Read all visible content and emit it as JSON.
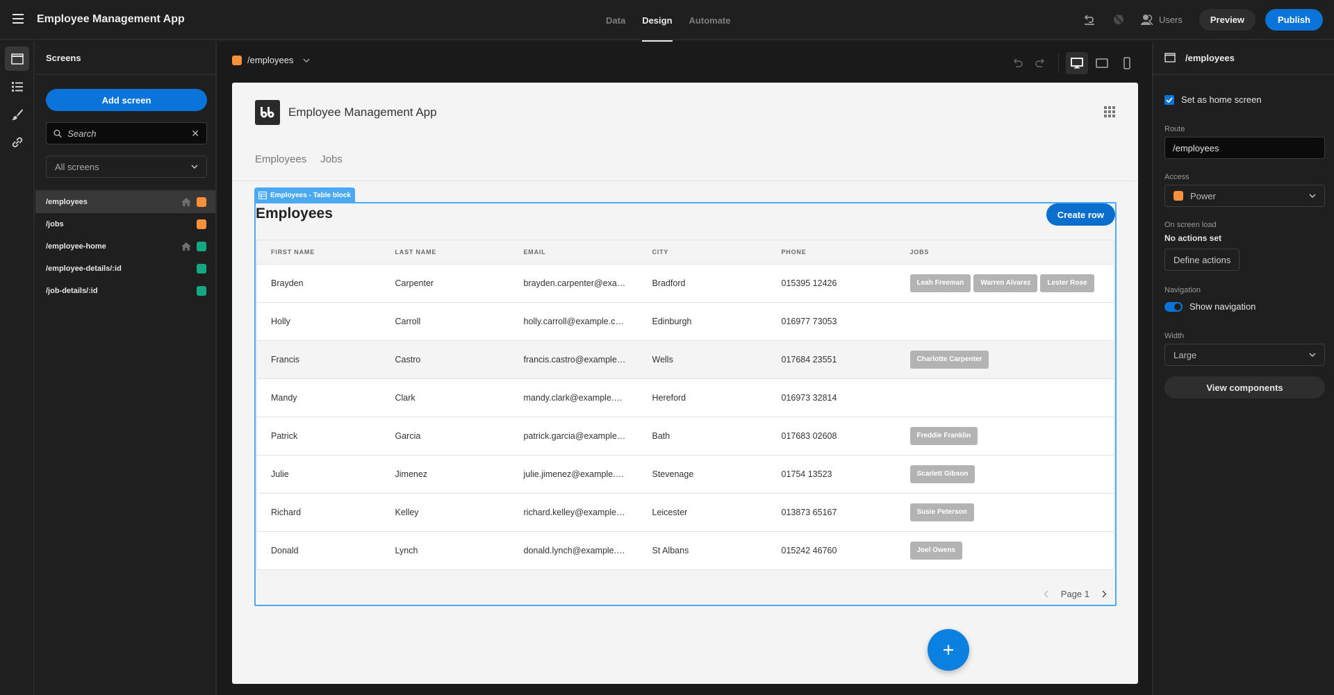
{
  "app": {
    "title": "Employee Management App"
  },
  "top_tabs": [
    {
      "label": "Data",
      "active": false
    },
    {
      "label": "Design",
      "active": true
    },
    {
      "label": "Automate",
      "active": false
    }
  ],
  "top_right": {
    "users_label": "Users",
    "preview_label": "Preview",
    "publish_label": "Publish"
  },
  "rail": {
    "items": [
      "screens-icon",
      "components-list-icon",
      "theme-brush-icon",
      "link-icon"
    ]
  },
  "screens_panel": {
    "title": "Screens",
    "add_button": "Add screen",
    "search_placeholder": "Search",
    "filter_value": "All screens",
    "items": [
      {
        "route": "/employees",
        "home": true,
        "role_color": "#f7903a",
        "active": true
      },
      {
        "route": "/jobs",
        "home": false,
        "role_color": "#f7903a",
        "active": false
      },
      {
        "route": "/employee-home",
        "home": true,
        "role_color": "#14a882",
        "active": false
      },
      {
        "route": "/employee-details/:id",
        "home": false,
        "role_color": "#14a882",
        "active": false
      },
      {
        "route": "/job-details/:id",
        "home": false,
        "role_color": "#14a882",
        "active": false
      }
    ]
  },
  "canvas": {
    "route": "/employees",
    "route_color": "#f7903a",
    "device_modes": [
      "desktop",
      "tablet",
      "mobile"
    ],
    "active_device": "desktop"
  },
  "preview": {
    "app_name": "Employee Management App",
    "nav": [
      "Employees",
      "Jobs"
    ],
    "block_label": "Employees - Table block",
    "table_title": "Employees",
    "create_row_label": "Create row",
    "columns": [
      "FIRST NAME",
      "LAST NAME",
      "EMAIL",
      "CITY",
      "PHONE",
      "JOBS"
    ],
    "rows": [
      {
        "first": "Brayden",
        "last": "Carpenter",
        "email": "brayden.carpenter@exa…",
        "city": "Bradford",
        "phone": "015395 12426",
        "jobs": [
          "Leah Freeman",
          "Warren Alvarez",
          "Lester Rose"
        ]
      },
      {
        "first": "Holly",
        "last": "Carroll",
        "email": "holly.carroll@example.c…",
        "city": "Edinburgh",
        "phone": "016977 73053",
        "jobs": []
      },
      {
        "first": "Francis",
        "last": "Castro",
        "email": "francis.castro@example…",
        "city": "Wells",
        "phone": "017684 23551",
        "jobs": [
          "Charlotte Carpenter"
        ]
      },
      {
        "first": "Mandy",
        "last": "Clark",
        "email": "mandy.clark@example.…",
        "city": "Hereford",
        "phone": "016973 32814",
        "jobs": []
      },
      {
        "first": "Patrick",
        "last": "Garcia",
        "email": "patrick.garcia@example…",
        "city": "Bath",
        "phone": "017683 02608",
        "jobs": [
          "Freddie Franklin"
        ]
      },
      {
        "first": "Julie",
        "last": "Jimenez",
        "email": "julie.jimenez@example.…",
        "city": "Stevenage",
        "phone": "01754 13523",
        "jobs": [
          "Scarlett Gibson"
        ]
      },
      {
        "first": "Richard",
        "last": "Kelley",
        "email": "richard.kelley@example…",
        "city": "Leicester",
        "phone": "013873 65167",
        "jobs": [
          "Susie Peterson"
        ]
      },
      {
        "first": "Donald",
        "last": "Lynch",
        "email": "donald.lynch@example.…",
        "city": "St Albans",
        "phone": "015242 46760",
        "jobs": [
          "Joel Owens"
        ]
      }
    ],
    "page_label": "Page 1",
    "fab_icon": "plus-icon"
  },
  "settings_panel": {
    "title": "/employees",
    "home_checkbox_label": "Set as home screen",
    "home_checked": true,
    "route_label": "Route",
    "route_value": "/employees",
    "access_label": "Access",
    "access_value": "Power",
    "access_color": "#f7903a",
    "on_load_label": "On screen load",
    "no_actions": "No actions set",
    "define_actions": "Define actions",
    "navigation_label": "Navigation",
    "show_navigation_label": "Show navigation",
    "show_navigation": true,
    "width_label": "Width",
    "width_value": "Large",
    "view_components": "View components"
  }
}
